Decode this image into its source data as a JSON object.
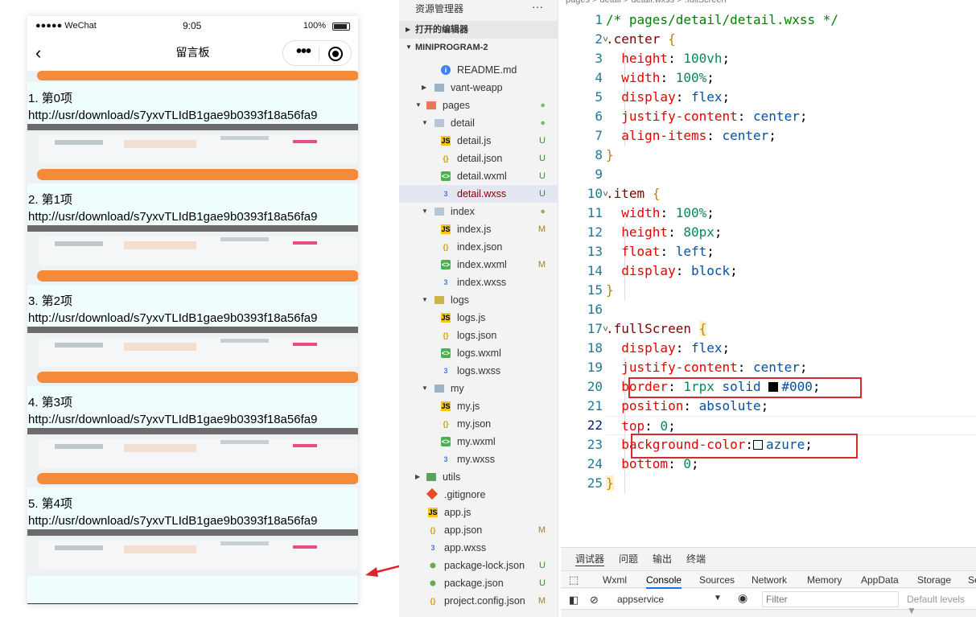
{
  "phone": {
    "status": {
      "carrier": "●●●●● WeChat",
      "time": "9:05",
      "battery": "100%"
    },
    "nav": {
      "back": "‹",
      "title": "留言板",
      "more": "•••"
    },
    "items": [
      {
        "title": "1. 第0项",
        "url": "http://usr/download/s7yxvTLIdB1gae9b0393f18a56fa9"
      },
      {
        "title": "2. 第1项",
        "url": "http://usr/download/s7yxvTLIdB1gae9b0393f18a56fa9"
      },
      {
        "title": "3. 第2项",
        "url": "http://usr/download/s7yxvTLIdB1gae9b0393f18a56fa9"
      },
      {
        "title": "4. 第3项",
        "url": "http://usr/download/s7yxvTLIdB1gae9b0393f18a56fa9"
      },
      {
        "title": "5. 第4项",
        "url": "http://usr/download/s7yxvTLIdB1gae9b0393f18a56fa9"
      }
    ]
  },
  "explorer": {
    "header": "资源管理器",
    "more": "···",
    "open_editors": "打开的编辑器",
    "project": "MINIPROGRAM-2",
    "files": [
      {
        "name": "README.md",
        "icon": "info",
        "glyph": "i",
        "status": ""
      },
      {
        "name": "vant-weapp",
        "icon": "folder",
        "glyph": "",
        "status": ""
      },
      {
        "name": "pages",
        "icon": "folder pages",
        "glyph": "",
        "status": "●"
      },
      {
        "name": "detail",
        "icon": "folder open",
        "glyph": "",
        "status": "●"
      },
      {
        "name": "detail.js",
        "icon": "js",
        "glyph": "JS",
        "status": "U"
      },
      {
        "name": "detail.json",
        "icon": "json",
        "glyph": "{}",
        "status": "U"
      },
      {
        "name": "detail.wxml",
        "icon": "wxml",
        "glyph": "<>",
        "status": "U"
      },
      {
        "name": "detail.wxss",
        "icon": "wxss",
        "glyph": "3",
        "status": "U"
      },
      {
        "name": "index",
        "icon": "folder open",
        "glyph": "",
        "status": "●"
      },
      {
        "name": "index.js",
        "icon": "js",
        "glyph": "JS",
        "status": "M"
      },
      {
        "name": "index.json",
        "icon": "json",
        "glyph": "{}",
        "status": ""
      },
      {
        "name": "index.wxml",
        "icon": "wxml",
        "glyph": "<>",
        "status": "M"
      },
      {
        "name": "index.wxss",
        "icon": "wxss",
        "glyph": "3",
        "status": ""
      },
      {
        "name": "logs",
        "icon": "folder logs",
        "glyph": "",
        "status": ""
      },
      {
        "name": "logs.js",
        "icon": "js",
        "glyph": "JS",
        "status": ""
      },
      {
        "name": "logs.json",
        "icon": "json",
        "glyph": "{}",
        "status": ""
      },
      {
        "name": "logs.wxml",
        "icon": "wxml",
        "glyph": "<>",
        "status": ""
      },
      {
        "name": "logs.wxss",
        "icon": "wxss",
        "glyph": "3",
        "status": ""
      },
      {
        "name": "my",
        "icon": "folder my",
        "glyph": "",
        "status": ""
      },
      {
        "name": "my.js",
        "icon": "js",
        "glyph": "JS",
        "status": ""
      },
      {
        "name": "my.json",
        "icon": "json",
        "glyph": "{}",
        "status": ""
      },
      {
        "name": "my.wxml",
        "icon": "wxml",
        "glyph": "<>",
        "status": ""
      },
      {
        "name": "my.wxss",
        "icon": "wxss",
        "glyph": "3",
        "status": ""
      },
      {
        "name": "utils",
        "icon": "folder utils",
        "glyph": "",
        "status": ""
      },
      {
        "name": ".gitignore",
        "icon": "git",
        "glyph": "",
        "status": ""
      },
      {
        "name": "app.js",
        "icon": "js",
        "glyph": "JS",
        "status": ""
      },
      {
        "name": "app.json",
        "icon": "json",
        "glyph": "{}",
        "status": "M"
      },
      {
        "name": "app.wxss",
        "icon": "wxss",
        "glyph": "3",
        "status": ""
      },
      {
        "name": "package-lock.json",
        "icon": "lock",
        "glyph": "⬢",
        "status": "U"
      },
      {
        "name": "package.json",
        "icon": "lock",
        "glyph": "⬢",
        "status": "U"
      },
      {
        "name": "project.config.json",
        "icon": "json",
        "glyph": "{}",
        "status": "M"
      }
    ]
  },
  "editor": {
    "breadcrumb": "pages > detail > detail.wxss > .fullScreen",
    "lines": [
      "1",
      "2",
      "3",
      "4",
      "5",
      "6",
      "7",
      "8",
      "9",
      "10",
      "11",
      "12",
      "13",
      "14",
      "15",
      "16",
      "17",
      "18",
      "19",
      "20",
      "21",
      "22",
      "23",
      "24",
      "25"
    ],
    "code": {
      "c1": "/* pages/detail/detail.wxss */",
      "c2": ".center",
      "c3p": "height",
      "c3v": "100vh",
      "c4p": "width",
      "c4v": "100%",
      "c5p": "display",
      "c5v": "flex",
      "c6p": "justify-content",
      "c6v": "center",
      "c7p": "align-items",
      "c7v": "center",
      "c10": ".item",
      "c11p": "width",
      "c11v": "100%",
      "c12p": "height",
      "c12v": "80px",
      "c13p": "float",
      "c13v": "left",
      "c14p": "display",
      "c14v": "block",
      "c17": ".fullScreen",
      "c18p": "display",
      "c18v": "flex",
      "c19p": "justify-content",
      "c19v": "center",
      "c20p": "border",
      "c20v1": "1rpx",
      "c20v2": "solid",
      "c20v3": "#000",
      "c21p": "position",
      "c21v": "absolute",
      "c22p": "top",
      "c22v": "0",
      "c23p": "background-color",
      "c23v": "azure",
      "c24p": "bottom",
      "c24v": "0"
    }
  },
  "panel": {
    "tabs": [
      "调试器",
      "问题",
      "输出",
      "终端"
    ],
    "devtabs": [
      "Wxml",
      "Console",
      "Sources",
      "Network",
      "Memory",
      "AppData",
      "Storage",
      "Se"
    ],
    "context": "appservice",
    "filter_placeholder": "Filter",
    "levels": "Default levels ▼"
  }
}
